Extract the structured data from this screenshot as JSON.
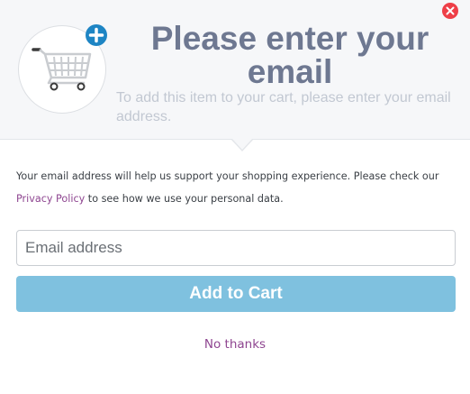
{
  "dialog": {
    "title": "Please enter your email",
    "subtitle": "To add this item to your cart, please enter your email address.",
    "disclaimer": {
      "before_link": "Your email address will help us support your shopping experience. Please check our ",
      "link_text": "Privacy Policy",
      "after_link": " to see how we use your personal data."
    },
    "email_input": {
      "placeholder": "Email address",
      "value": ""
    },
    "submit_label": "Add to Cart",
    "dismiss_label": "No thanks"
  },
  "icons": {
    "close": "close-icon",
    "cart": "shopping-cart-icon",
    "plus": "plus-icon"
  },
  "colors": {
    "title": "#6e7891",
    "subtitle": "#c2c8d2",
    "link": "#8e4590",
    "button": "#7fc1df",
    "close": "#ee3f48",
    "plus_badge": "#1e85c4",
    "header_bg": "#f6f7f9"
  }
}
